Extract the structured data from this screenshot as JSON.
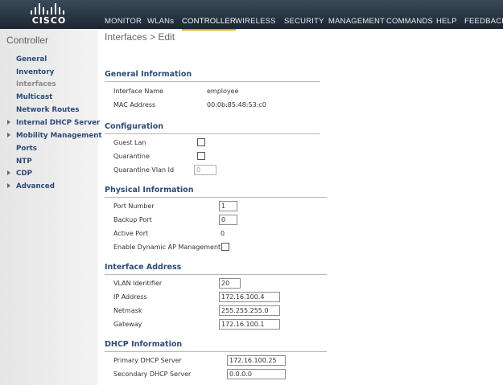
{
  "brand": {
    "logo_text": "CISCO"
  },
  "nav": [
    {
      "label": "MONITOR"
    },
    {
      "label": "WLANs"
    },
    {
      "label": "CONTROLLER",
      "active": true
    },
    {
      "label": "WIRELESS"
    },
    {
      "label": "SECURITY"
    },
    {
      "label": "MANAGEMENT"
    },
    {
      "label": "COMMANDS"
    },
    {
      "label": "HELP"
    },
    {
      "label": "FEEDBACK"
    }
  ],
  "sidebar": {
    "title": "Controller",
    "items": [
      {
        "label": "General",
        "expandable": false
      },
      {
        "label": "Inventory",
        "expandable": false
      },
      {
        "label": "Interfaces",
        "expandable": false,
        "active": true
      },
      {
        "label": "Multicast",
        "expandable": false
      },
      {
        "label": "Network Routes",
        "expandable": false
      },
      {
        "label": "Internal DHCP Server",
        "expandable": true
      },
      {
        "label": "Mobility Management",
        "expandable": true
      },
      {
        "label": "Ports",
        "expandable": false
      },
      {
        "label": "NTP",
        "expandable": false
      },
      {
        "label": "CDP",
        "expandable": true
      },
      {
        "label": "Advanced",
        "expandable": true
      }
    ]
  },
  "page": {
    "title": "Interfaces > Edit"
  },
  "general": {
    "heading": "General Information",
    "interface_name_label": "Interface Name",
    "interface_name": "employee",
    "mac_label": "MAC Address",
    "mac": "00:0b:85:48:53:c0"
  },
  "configuration": {
    "heading": "Configuration",
    "guest_lan_label": "Guest Lan",
    "guest_lan_checked": false,
    "quarantine_label": "Quarantine",
    "quarantine_checked": false,
    "quarantine_vlan_label": "Quarantine Vlan Id",
    "quarantine_vlan_value": "0"
  },
  "physical": {
    "heading": "Physical Information",
    "port_number_label": "Port Number",
    "port_number": "1",
    "backup_port_label": "Backup Port",
    "backup_port": "0",
    "active_port_label": "Active Port",
    "active_port": "0",
    "dynamic_ap_label": "Enable Dynamic AP Management",
    "dynamic_ap_checked": false
  },
  "address": {
    "heading": "Interface Address",
    "vlan_label": "VLAN Identifier",
    "vlan": "20",
    "ip_label": "IP Address",
    "ip": "172.16.100.4",
    "netmask_label": "Netmask",
    "netmask": "255.255.255.0",
    "gateway_label": "Gateway",
    "gateway": "172.16.100.1"
  },
  "dhcp": {
    "heading": "DHCP Information",
    "primary_label": "Primary DHCP Server",
    "primary": "172.16.100.25",
    "secondary_label": "Secondary DHCP Server",
    "secondary": "0.0.0.0"
  },
  "colors": {
    "topbar": "#24303c",
    "nav_active_underline": "#e8a317",
    "section_heading": "#2d4a7a",
    "sidebar_link": "#2d4a7a"
  }
}
